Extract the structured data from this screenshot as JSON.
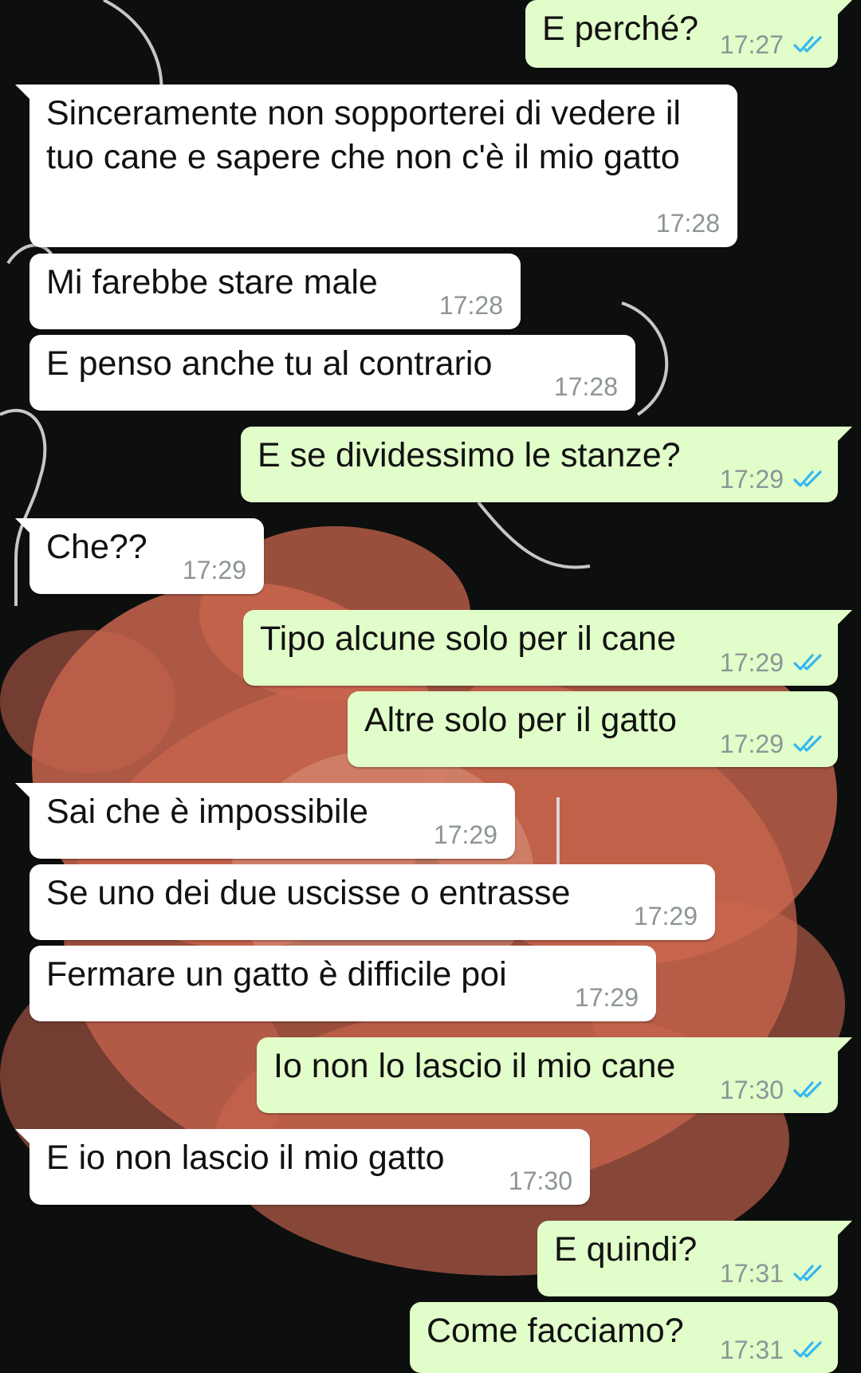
{
  "theme": {
    "incoming_bubble": "#ffffff",
    "outgoing_bubble": "#e1fdc9",
    "time_color": "#8d9597",
    "read_check_color": "#34b7f1",
    "flower_color": "#c9654e",
    "background_color": "#0d0f0f"
  },
  "chat": {
    "messages": [
      {
        "dir": "out",
        "text": "E perché?",
        "time": "17:27",
        "status": "read-double-check-icon"
      },
      {
        "dir": "in",
        "text": "Sinceramente non sopporterei di vedere il tuo cane e sapere che non c'è il mio gatto",
        "time": "17:28"
      },
      {
        "dir": "in",
        "text": "Mi farebbe stare male",
        "time": "17:28"
      },
      {
        "dir": "in",
        "text": "E penso anche tu al contrario",
        "time": "17:28"
      },
      {
        "dir": "out",
        "text": "E se dividessimo le stanze?",
        "time": "17:29",
        "status": "read-double-check-icon"
      },
      {
        "dir": "in",
        "text": "Che??",
        "time": "17:29"
      },
      {
        "dir": "out",
        "text": "Tipo alcune solo per il cane",
        "time": "17:29",
        "status": "read-double-check-icon"
      },
      {
        "dir": "out",
        "text": "Altre solo per il gatto",
        "time": "17:29",
        "status": "read-double-check-icon"
      },
      {
        "dir": "in",
        "text": "Sai che è impossibile",
        "time": "17:29"
      },
      {
        "dir": "in",
        "text": "Se uno dei due uscisse o entrasse",
        "time": "17:29"
      },
      {
        "dir": "in",
        "text": "Fermare un gatto è difficile poi",
        "time": "17:29"
      },
      {
        "dir": "out",
        "text": "Io non lo lascio il mio cane",
        "time": "17:30",
        "status": "read-double-check-icon"
      },
      {
        "dir": "in",
        "text": "E io non lascio il mio gatto",
        "time": "17:30"
      },
      {
        "dir": "out",
        "text": "E quindi?",
        "time": "17:31",
        "status": "read-double-check-icon"
      },
      {
        "dir": "out",
        "text": "Come facciamo?",
        "time": "17:31",
        "status": "read-double-check-icon"
      }
    ]
  }
}
